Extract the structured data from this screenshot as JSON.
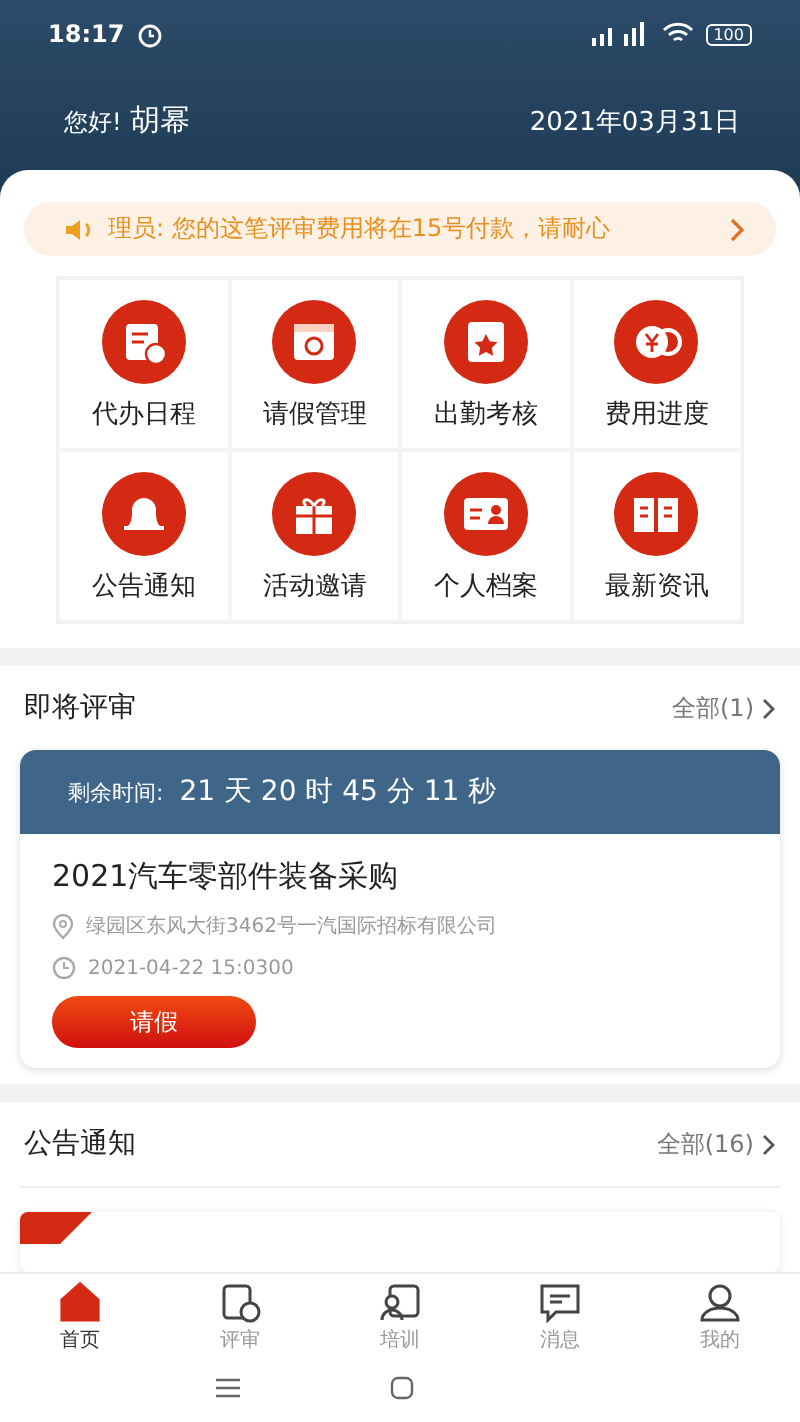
{
  "status_bar": {
    "time": "18:17",
    "battery": "100"
  },
  "header": {
    "greeting": "您好!",
    "name": "胡幂",
    "date": "2021年03月31日"
  },
  "notice_bar": {
    "text": "理员: 您的这笔评审费用将在15号付款，请耐心"
  },
  "shortcuts": [
    {
      "label": "代办日程",
      "kind": "schedule"
    },
    {
      "label": "请假管理",
      "kind": "calendar"
    },
    {
      "label": "出勤考核",
      "kind": "star"
    },
    {
      "label": "费用进度",
      "kind": "coin"
    },
    {
      "label": "公告通知",
      "kind": "bell"
    },
    {
      "label": "活动邀请",
      "kind": "gift"
    },
    {
      "label": "个人档案",
      "kind": "card"
    },
    {
      "label": "最新资讯",
      "kind": "book"
    }
  ],
  "upcoming": {
    "title": "即将评审",
    "more": "全部(1)",
    "countdown_label": "剩余时间:",
    "countdown": "21 天 20 时 45 分 11 秒",
    "item_title": "2021汽车零部件装备采购",
    "address": "绿园区东风大街3462号一汽国际招标有限公司",
    "time": "2021-04-22 15:0300",
    "button": "请假"
  },
  "announcements": {
    "title": "公告通知",
    "more": "全部(16)"
  },
  "tabs": [
    {
      "label": "首页",
      "kind": "home",
      "selected": true
    },
    {
      "label": "评审",
      "kind": "review",
      "selected": false
    },
    {
      "label": "培训",
      "kind": "training",
      "selected": false
    },
    {
      "label": "消息",
      "kind": "message",
      "selected": false
    },
    {
      "label": "我的",
      "kind": "profile",
      "selected": false
    }
  ]
}
